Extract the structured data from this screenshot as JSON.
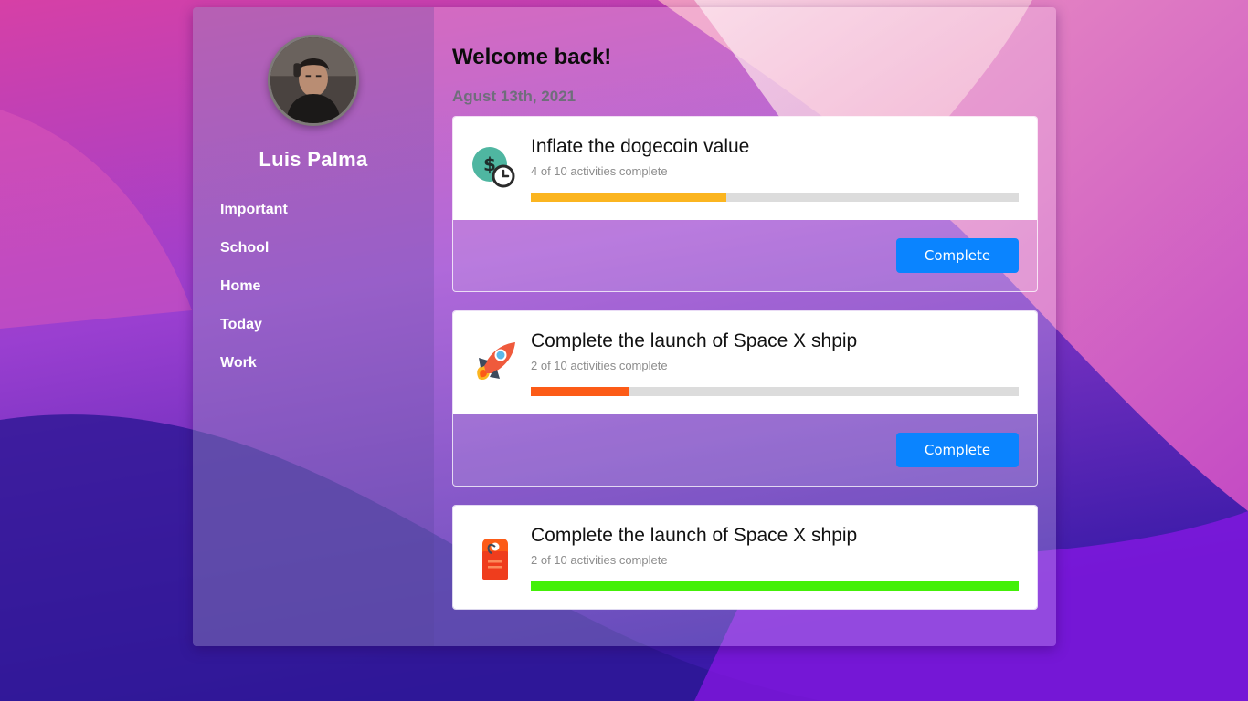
{
  "user": {
    "name": "Luis Palma",
    "avatar_icon": "user-photo-icon"
  },
  "sidebar": {
    "items": [
      {
        "label": "Important"
      },
      {
        "label": "School"
      },
      {
        "label": "Home"
      },
      {
        "label": "Today"
      },
      {
        "label": "Work"
      }
    ]
  },
  "main": {
    "welcome": "Welcome back!",
    "date": "Agust 13th, 2021"
  },
  "tasks": [
    {
      "title": "Inflate the dogecoin value",
      "subtitle": "4 of 10 activities complete",
      "progress": 0.4,
      "progress_color": "#fbb520",
      "icon": "money-time-icon",
      "button_label": "Complete"
    },
    {
      "title": "Complete the launch of Space X shpip",
      "subtitle": "2 of 10 activities complete",
      "progress": 0.2,
      "progress_color": "#fc5b17",
      "icon": "rocket-icon",
      "button_label": "Complete"
    },
    {
      "title": "Complete the launch of Space X shpip",
      "subtitle": "2 of 10 activities complete",
      "progress": 1.0,
      "progress_color": "#44f008",
      "icon": "price-tag-icon"
    }
  ],
  "colors": {
    "accent": "#0a84ff"
  }
}
